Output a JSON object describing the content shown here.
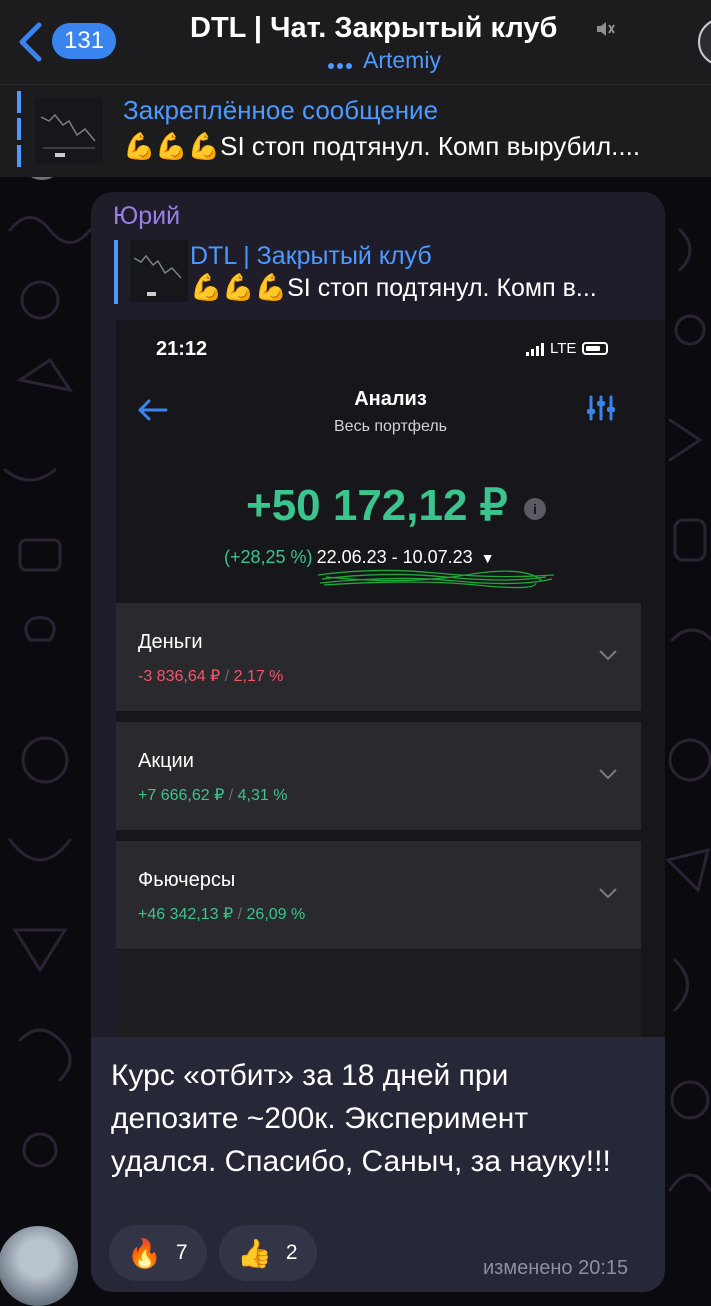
{
  "header": {
    "back_count": "131",
    "title": "DTL | Чат. Закрытый клуб",
    "subtitle": "Artemiy"
  },
  "pinned": {
    "title": "Закреплённое сообщение",
    "text": "SI стоп подтянул. Комп вырубил...."
  },
  "message": {
    "sender": "Юрий",
    "reply": {
      "title": "DTL | Закрытый клуб",
      "text": "SI стоп подтянул. Комп в..."
    },
    "screenshot": {
      "time": "21:12",
      "network": "LTE",
      "nav_title": "Анализ",
      "nav_subtitle": "Весь портфель",
      "amount": "+50 172,12 ₽",
      "info": "i",
      "percent": "(+28,25 %)",
      "dates": "22.06.23 - 10.07.23",
      "caret": "▼",
      "cards": [
        {
          "name": "Деньги",
          "value": "-3 836,64 ₽",
          "sep": "/",
          "pct": "2,17 %",
          "tone": "neg"
        },
        {
          "name": "Акции",
          "value": "+7 666,62 ₽",
          "sep": "/",
          "pct": "4,31 %",
          "tone": "pos"
        },
        {
          "name": "Фьючерсы",
          "value": "+46 342,13 ₽",
          "sep": "/",
          "pct": "26,09 %",
          "tone": "pos"
        }
      ]
    },
    "caption": "Курс «отбит» за 18 дней при депозите ~200к. Эксперимент удался. Спасибо, Саныч, за науку!!!",
    "reactions": [
      {
        "emoji": "fire-icon",
        "count": "7"
      },
      {
        "emoji": "thumbs-up-icon",
        "count": "2"
      }
    ],
    "edited": "изменено 20:15"
  },
  "colors": {
    "accent": "#4c9aff",
    "sender": "#9b7fe8",
    "positive": "#3bc48d",
    "negative": "#f1586a",
    "badge": "#3a84f0"
  }
}
